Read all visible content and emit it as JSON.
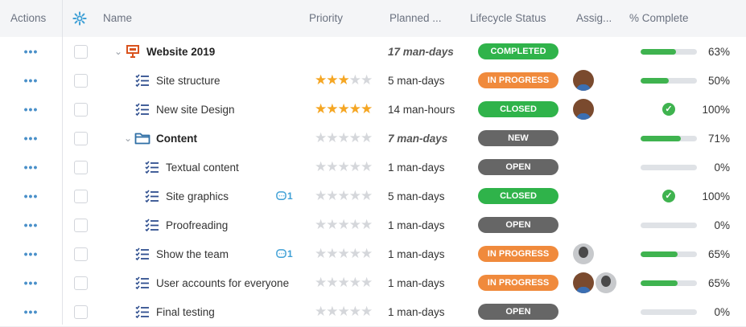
{
  "header": {
    "actions": "Actions",
    "name": "Name",
    "priority": "Priority",
    "planned": "Planned ...",
    "lifecycle": "Lifecycle Status",
    "assigned": "Assig...",
    "complete": "% Complete"
  },
  "colors": {
    "completed": "#2fb34a",
    "in_progress": "#f08a3c",
    "closed": "#2fb34a",
    "new": "#666666",
    "open": "#666666",
    "progress_fill": "#3fb34f"
  },
  "rows": [
    {
      "name": "Website 2019",
      "bold": true,
      "indent": 0,
      "icon": "project-icon",
      "chevron": true,
      "stars": 0,
      "stars_visible": false,
      "planned": "17 man-days",
      "planned_italic": true,
      "status": "COMPLETED",
      "status_color": "#2fb34a",
      "assignees": [],
      "progress": 0.63,
      "done": false,
      "pct": "63%",
      "comments": ""
    },
    {
      "name": "Site structure",
      "bold": false,
      "indent": 1,
      "icon": "task-list-icon",
      "chevron": false,
      "stars": 3,
      "stars_visible": true,
      "planned": "5 man-days",
      "planned_italic": false,
      "status": "IN PROGRESS",
      "status_color": "#f08a3c",
      "assignees": [
        "dark"
      ],
      "progress": 0.5,
      "done": false,
      "pct": "50%",
      "comments": ""
    },
    {
      "name": "New site Design",
      "bold": false,
      "indent": 1,
      "icon": "task-list-icon",
      "chevron": false,
      "stars": 5,
      "stars_visible": true,
      "planned": "14 man-hours",
      "planned_italic": false,
      "status": "CLOSED",
      "status_color": "#2fb34a",
      "assignees": [
        "dark"
      ],
      "progress": 1.0,
      "done": true,
      "pct": "100%",
      "comments": ""
    },
    {
      "name": "Content",
      "bold": true,
      "indent": 1,
      "icon": "folder-icon",
      "chevron": true,
      "stars": 0,
      "stars_visible": true,
      "planned": "7 man-days",
      "planned_italic": true,
      "status": "NEW",
      "status_color": "#666666",
      "assignees": [],
      "progress": 0.71,
      "done": false,
      "pct": "71%",
      "comments": ""
    },
    {
      "name": "Textual content",
      "bold": false,
      "indent": 2,
      "icon": "task-list-icon",
      "chevron": false,
      "stars": 0,
      "stars_visible": true,
      "planned": "1 man-days",
      "planned_italic": false,
      "status": "OPEN",
      "status_color": "#666666",
      "assignees": [],
      "progress": 0.0,
      "done": false,
      "pct": "0%",
      "comments": ""
    },
    {
      "name": "Site graphics",
      "bold": false,
      "indent": 2,
      "icon": "task-list-icon",
      "chevron": false,
      "stars": 0,
      "stars_visible": true,
      "planned": "5 man-days",
      "planned_italic": false,
      "status": "CLOSED",
      "status_color": "#2fb34a",
      "assignees": [],
      "progress": 1.0,
      "done": true,
      "pct": "100%",
      "comments": "1"
    },
    {
      "name": "Proofreading",
      "bold": false,
      "indent": 2,
      "icon": "task-list-icon",
      "chevron": false,
      "stars": 0,
      "stars_visible": true,
      "planned": "1 man-days",
      "planned_italic": false,
      "status": "OPEN",
      "status_color": "#666666",
      "assignees": [],
      "progress": 0.0,
      "done": false,
      "pct": "0%",
      "comments": ""
    },
    {
      "name": "Show the team",
      "bold": false,
      "indent": 1,
      "icon": "task-list-icon",
      "chevron": false,
      "stars": 0,
      "stars_visible": true,
      "planned": "1 man-days",
      "planned_italic": false,
      "status": "IN PROGRESS",
      "status_color": "#f08a3c",
      "assignees": [
        "gray"
      ],
      "progress": 0.65,
      "done": false,
      "pct": "65%",
      "comments": "1"
    },
    {
      "name": "User accounts for everyone",
      "bold": false,
      "indent": 1,
      "icon": "task-list-icon",
      "chevron": false,
      "stars": 0,
      "stars_visible": true,
      "planned": "1 man-days",
      "planned_italic": false,
      "status": "IN PROGRESS",
      "status_color": "#f08a3c",
      "assignees": [
        "dark",
        "gray"
      ],
      "progress": 0.65,
      "done": false,
      "pct": "65%",
      "comments": ""
    },
    {
      "name": "Final testing",
      "bold": false,
      "indent": 1,
      "icon": "task-list-icon",
      "chevron": false,
      "stars": 0,
      "stars_visible": true,
      "planned": "1 man-days",
      "planned_italic": false,
      "status": "OPEN",
      "status_color": "#666666",
      "assignees": [],
      "progress": 0.0,
      "done": false,
      "pct": "0%",
      "comments": ""
    }
  ]
}
